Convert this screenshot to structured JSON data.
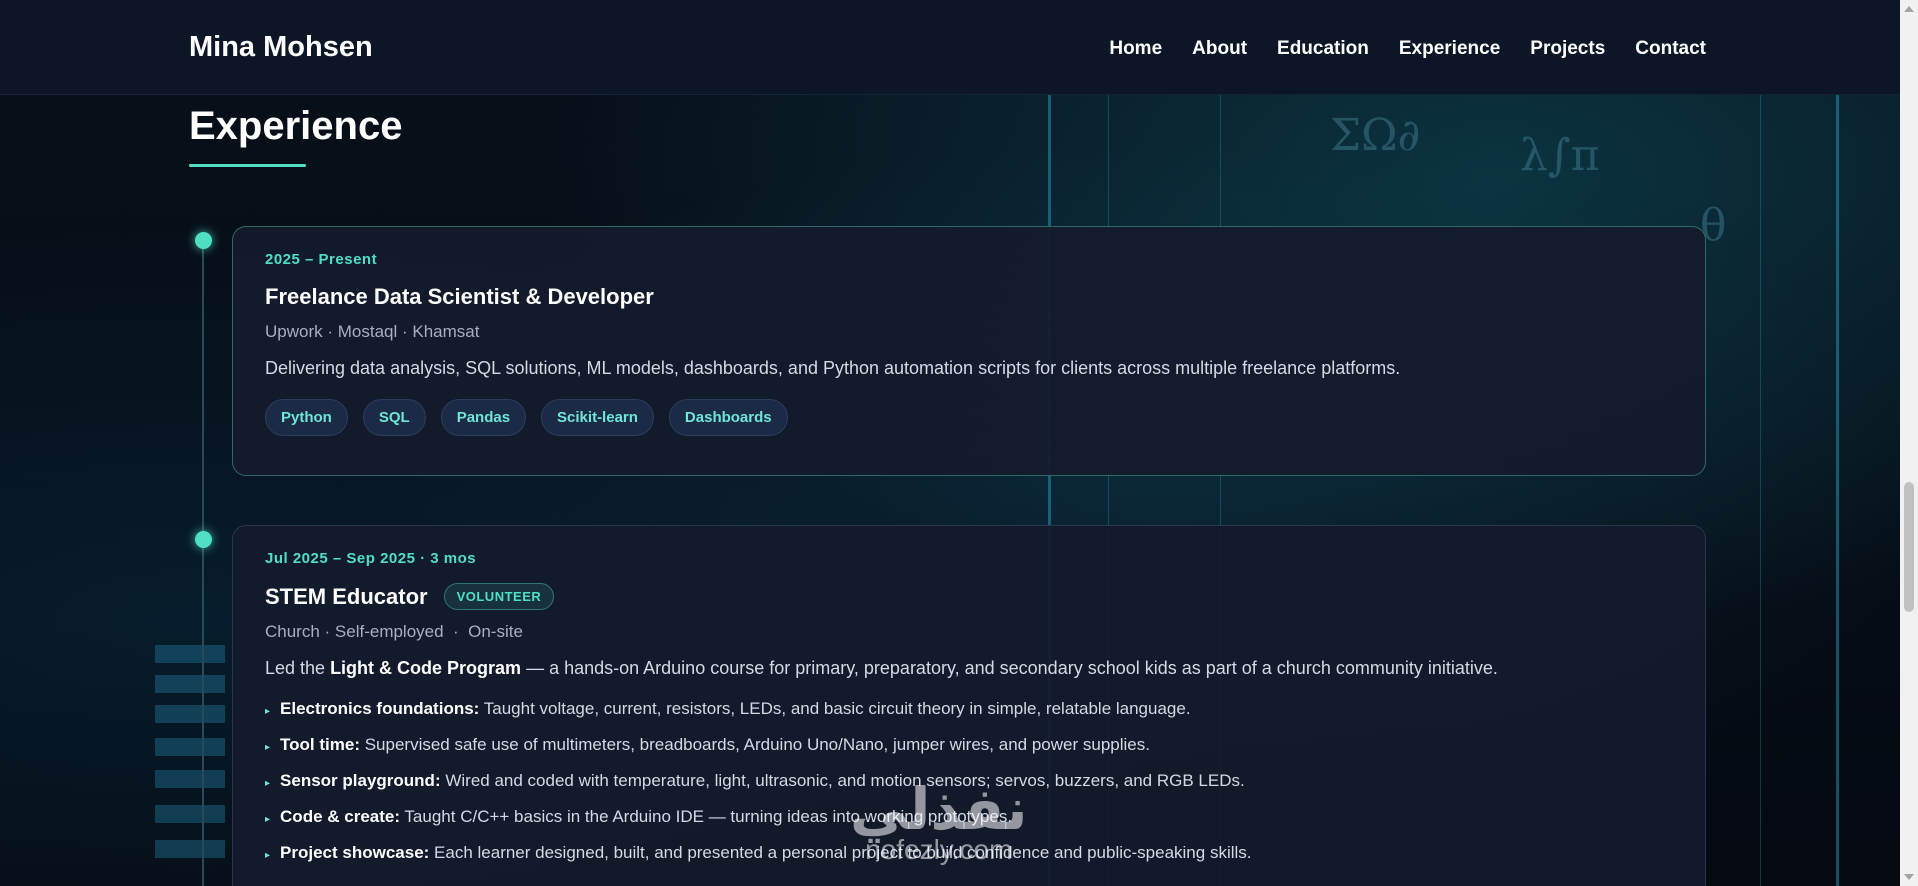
{
  "brand": "Mina Mohsen",
  "nav": [
    "Home",
    "About",
    "Education",
    "Experience",
    "Projects",
    "Contact"
  ],
  "section_title": "Experience",
  "experience": [
    {
      "date": "2025 – Present",
      "role": "Freelance Data Scientist & Developer",
      "company": "Upwork · Mostaql · Khamsat",
      "description": "Delivering data analysis, SQL solutions, ML models, dashboards, and Python automation scripts for clients across multiple freelance platforms.",
      "tags": [
        "Python",
        "SQL",
        "Pandas",
        "Scikit-learn",
        "Dashboards"
      ]
    },
    {
      "date": "Jul 2025 – Sep 2025 · 3 mos",
      "role": "STEM Educator",
      "badge": "VOLUNTEER",
      "company": "Church · Self-employed  ·  On-site",
      "description_prefix": "Led the ",
      "description_bold": "Light & Code Program",
      "description_suffix": " — a hands-on Arduino course for primary, preparatory, and secondary school kids as part of a church community initiative.",
      "bullets": [
        {
          "title": "Electronics foundations:",
          "text": " Taught voltage, current, resistors, LEDs, and basic circuit theory in simple, relatable language."
        },
        {
          "title": "Tool time:",
          "text": " Supervised safe use of multimeters, breadboards, Arduino Uno/Nano, jumper wires, and power supplies."
        },
        {
          "title": "Sensor playground:",
          "text": " Wired and coded with temperature, light, ultrasonic, and motion sensors; servos, buzzers, and RGB LEDs."
        },
        {
          "title": "Code & create:",
          "text": " Taught C/C++ basics in the Arduino IDE — turning ideas into working prototypes."
        },
        {
          "title": "Project showcase:",
          "text": " Each learner designed, built, and presented a personal project to build confidence and public-speaking skills."
        }
      ]
    }
  ],
  "watermark": {
    "logo": "نفذلي",
    "url": "nofezly.com"
  },
  "colors": {
    "accent": "#4fe0c4",
    "nav_bg": "#0d1627",
    "card_bg": "#141b2c"
  },
  "icons": [
    "bullet-arrow-icon",
    "timeline-dot-icon"
  ]
}
